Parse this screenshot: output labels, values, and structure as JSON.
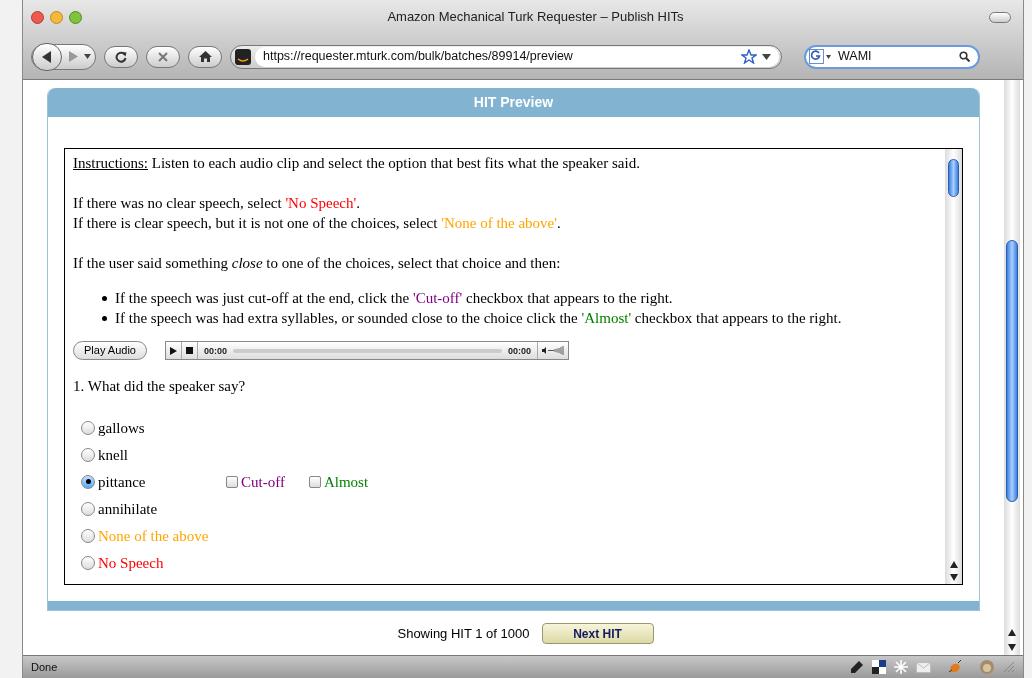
{
  "window": {
    "title": "Amazon Mechanical Turk Requester – Publish HITs"
  },
  "toolbar": {
    "url": "https://requester.mturk.com/bulk/batches/89914/preview",
    "search_value": "WAMI"
  },
  "hit_preview": {
    "header": "HIT Preview",
    "instructions_label": "Instructions:",
    "instructions_text": "Listen to each audio clip and select the option that best fits what the speaker said.",
    "paragraphs": [
      [
        {
          "text": "If there was no clear speech, select "
        },
        {
          "text": "'No Speech'",
          "color": "#ff0000"
        },
        {
          "text": "."
        }
      ],
      [
        {
          "text": "If there is clear speech, but it is not one of the choices, select "
        },
        {
          "text": "'None of the above'",
          "color": "#ffa500"
        },
        {
          "text": "."
        }
      ]
    ],
    "close_note": "If the user said something *close* to one of the choices, select that choice and then:",
    "bullets": [
      [
        {
          "text": "If the speech was just cut-off at the end, click the "
        },
        {
          "text": "'Cut-off'",
          "color": "#800080"
        },
        {
          "text": " checkbox that appears to the right."
        }
      ],
      [
        {
          "text": "If the speech was had extra syllables, or sounded close to the choice click the "
        },
        {
          "text": "'Almost'",
          "color": "#008000"
        },
        {
          "text": " checkbox that appears to the right."
        }
      ]
    ],
    "play_button": "Play Audio",
    "player": {
      "elapsed": "00:00",
      "duration": "00:00"
    },
    "question": "1. What did the speaker say?",
    "options": [
      {
        "label": "gallows",
        "selected": false,
        "color": "#000000"
      },
      {
        "label": "knell",
        "selected": false,
        "color": "#000000"
      },
      {
        "label": "pittance",
        "selected": true,
        "color": "#000000",
        "flags": [
          {
            "label": "Cut-off",
            "checked": false,
            "color": "#800080"
          },
          {
            "label": "Almost",
            "checked": false,
            "color": "#008000"
          }
        ]
      },
      {
        "label": "annihilate",
        "selected": false,
        "color": "#000000"
      },
      {
        "label": "None of the above",
        "selected": false,
        "color": "#ffa500"
      },
      {
        "label": "No Speech",
        "selected": false,
        "color": "#ff0000"
      }
    ]
  },
  "pager": {
    "text": "Showing HIT 1 of 1000",
    "next_button": "Next HIT"
  },
  "status_bar": {
    "text": "Done"
  }
}
